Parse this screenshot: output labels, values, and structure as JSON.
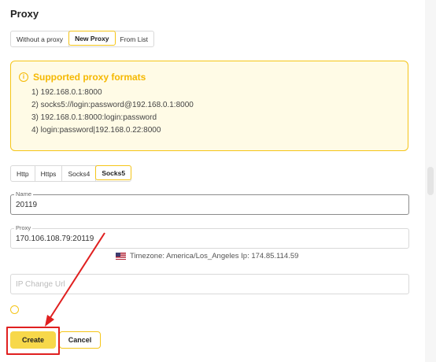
{
  "page": {
    "title": "Proxy"
  },
  "mode_tabs": [
    {
      "label": "Without a proxy",
      "active": false
    },
    {
      "label": "New Proxy",
      "active": true
    },
    {
      "label": "From List",
      "active": false
    }
  ],
  "info": {
    "title": "Supported proxy formats",
    "lines": [
      "1) 192.168.0.1:8000",
      "2) socks5://login:password@192.168.0.1:8000",
      "3) 192.168.0.1:8000:login:password",
      "4) login:password|192.168.0.22:8000"
    ]
  },
  "protocol_tabs": [
    {
      "label": "Http",
      "active": false
    },
    {
      "label": "Https",
      "active": false
    },
    {
      "label": "Socks4",
      "active": false
    },
    {
      "label": "Socks5",
      "active": true
    }
  ],
  "name_field": {
    "label": "Name",
    "value": "20119"
  },
  "proxy_field": {
    "label": "Proxy",
    "value": "170.106.108.79:20119"
  },
  "timezone_text": "Timezone: America/Los_Angeles Ip: 174.85.114.59",
  "ip_change": {
    "placeholder": "IP Change Url"
  },
  "buttons": {
    "create": "Create",
    "cancel": "Cancel"
  },
  "colors": {
    "accent": "#f5c518",
    "info_bg": "#fffbe6",
    "highlight": "#e02020"
  },
  "icons": {
    "info": "info-circle-icon",
    "flag": "us-flag-icon"
  }
}
